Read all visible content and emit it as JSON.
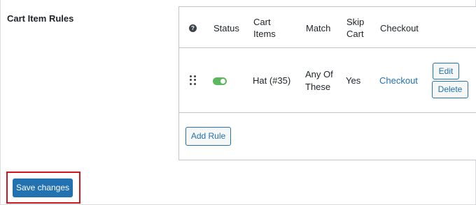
{
  "settings": {
    "section_label": "Cart Item Rules",
    "save_label": "Save changes"
  },
  "rules_table": {
    "help_icon_glyph": "?",
    "headers": {
      "status": "Status",
      "cart_items_1": "Cart",
      "cart_items_2": "Items",
      "match": "Match",
      "skip_cart_1": "Skip",
      "skip_cart_2": "Cart",
      "checkout": "Checkout"
    },
    "rows": [
      {
        "status_enabled": true,
        "status_color": "#5cb85c",
        "cart_items": "Hat (#35)",
        "match_1": "Any Of",
        "match_2": "These",
        "skip_cart": "Yes",
        "checkout_link": "Checkout",
        "edit_label": "Edit",
        "delete_label": "Delete"
      }
    ],
    "add_rule_label": "Add Rule"
  },
  "colors": {
    "accent": "#2271b1",
    "highlight": "#d9121f"
  }
}
